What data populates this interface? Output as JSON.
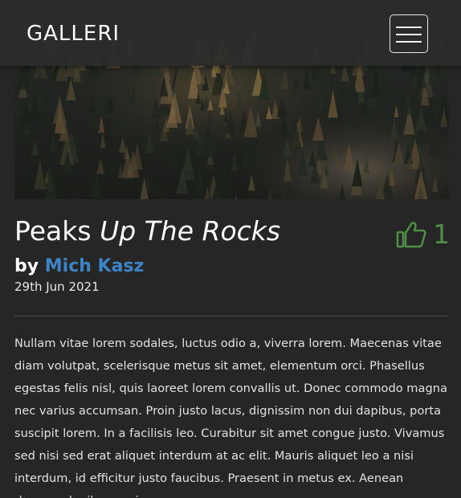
{
  "nav": {
    "brand": "GALLERI",
    "menu_icon": "hamburger-menu-icon"
  },
  "hero": {
    "image_icon": "forest-mountain-photo"
  },
  "post": {
    "title_plain": "Peaks",
    "title_emphasis": "Up The Rocks",
    "by_label": "by",
    "author": "Mich Kasz",
    "date": "29th Jun 2021",
    "likes": {
      "icon": "thumbs-up-icon",
      "count": "1",
      "color": "#4f8c46"
    },
    "body": "Nullam vitae lorem sodales, luctus odio a, viverra lorem. Maecenas vitae diam volutpat, scelerisque metus sit amet, elementum orci. Phasellus egestas felis nisl, quis laoreet lorem convallis ut. Donec commodo magna nec varius accumsan. Proin justo lacus, dignissim non dui dapibus, porta suscipit lorem. In a facilisis leo. Curabitur sit amet congue justo. Vivamus sed nisi sed erat aliquet interdum at ac elit. Mauris aliquet leo a nisi interdum, id efficitur justo faucibus. Praesent in metus ex. Aenean rhoncus dapibus sapien, non"
  },
  "colors": {
    "background": "#262626",
    "navbar": "#2c2c2c",
    "author_link": "#3d84c6",
    "likes": "#4f8c46",
    "text": "#e2e2e2"
  }
}
